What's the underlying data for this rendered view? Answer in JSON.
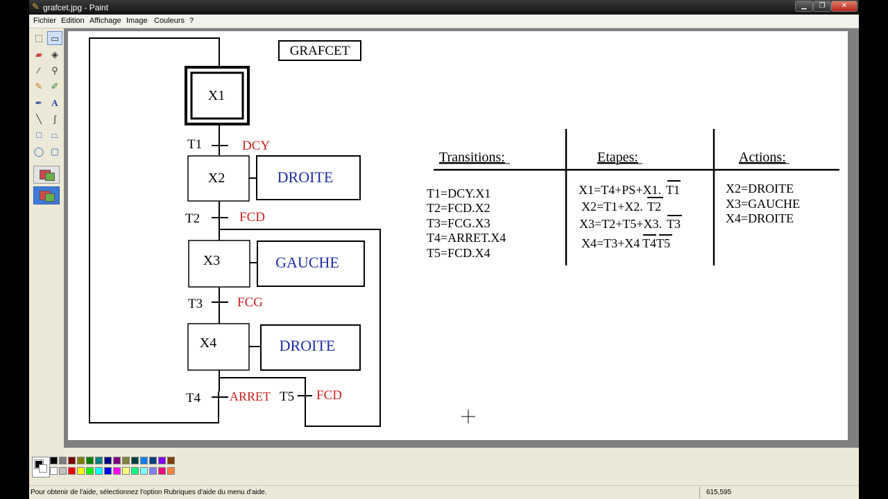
{
  "window": {
    "title": "grafcet.jpg - Paint"
  },
  "menu": [
    "Fichier",
    "Edition",
    "Affichage",
    "Image",
    "Couleurs",
    "?"
  ],
  "tools": [
    "free-select-icon",
    "rect-select-icon",
    "eraser-icon",
    "fill-icon",
    "color-picker-icon",
    "magnifier-icon",
    "pencil-icon",
    "brush-icon",
    "airbrush-icon",
    "text-icon",
    "line-icon",
    "curve-icon",
    "rectangle-icon",
    "polygon-icon",
    "ellipse-icon",
    "rounded-rect-icon"
  ],
  "colors": {
    "row1": [
      "#000000",
      "#808080",
      "#800000",
      "#808000",
      "#008000",
      "#008080",
      "#000080",
      "#800080",
      "#808040",
      "#004040",
      "#0080ff",
      "#004080",
      "#8000ff",
      "#804000"
    ],
    "row2": [
      "#ffffff",
      "#c0c0c0",
      "#ff0000",
      "#ffff00",
      "#00ff00",
      "#00ffff",
      "#0000ff",
      "#ff00ff",
      "#ffff80",
      "#00ff80",
      "#80ffff",
      "#8080ff",
      "#ff0080",
      "#ff8040"
    ],
    "signal_red": "#cc2020",
    "action_blue": "#1c2ea8"
  },
  "grafcet": {
    "title": "GRAFCET",
    "steps": [
      "X1",
      "X2",
      "X3",
      "X4"
    ],
    "transitions": [
      "T1",
      "T2",
      "T3",
      "T4",
      "T5"
    ],
    "conditions": [
      "DCY",
      "FCD",
      "FCG",
      "ARRET",
      "FCD"
    ],
    "actions": [
      "DROITE",
      "GAUCHE",
      "DROITE"
    ]
  },
  "table": {
    "headers": [
      "Transitions:",
      "Etapes:",
      "Actions:"
    ],
    "transitions": [
      "T1=DCY.X1",
      "T2=FCD.X2",
      "T3=FCG.X3",
      "T4=ARRET.X4",
      "T5=FCD.X4"
    ],
    "etapes": [
      {
        "main": "X1=T4+PS+X1.",
        "bar": "T1"
      },
      {
        "main": "X2=T1+X2.",
        "bar": "T2"
      },
      {
        "main": "X3=T2+T5+X3.",
        "bar": "T3"
      },
      {
        "main": "X4=T3+X4",
        "bar": "T4T5"
      }
    ],
    "actions": [
      "X2=DROITE",
      "X3=GAUCHE",
      "X4=DROITE"
    ]
  },
  "status": {
    "message": "Pour obtenir de l'aide, sélectionnez l'option Rubriques d'aide du menu d'aide.",
    "coords": "615,595"
  }
}
